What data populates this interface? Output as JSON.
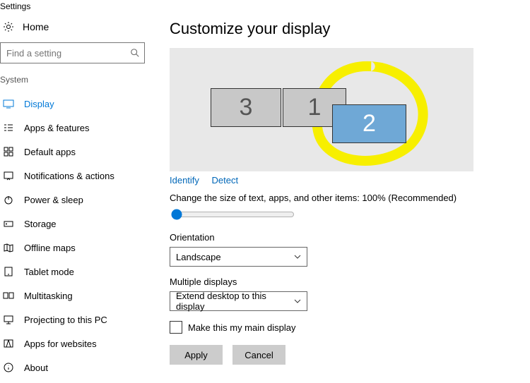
{
  "app_title": "Settings",
  "home_label": "Home",
  "search_placeholder": "Find a setting",
  "section_label": "System",
  "nav": [
    {
      "key": "display",
      "label": "Display",
      "active": true
    },
    {
      "key": "apps",
      "label": "Apps & features"
    },
    {
      "key": "default-apps",
      "label": "Default apps"
    },
    {
      "key": "notifications",
      "label": "Notifications & actions"
    },
    {
      "key": "power",
      "label": "Power & sleep"
    },
    {
      "key": "storage",
      "label": "Storage"
    },
    {
      "key": "offline-maps",
      "label": "Offline maps"
    },
    {
      "key": "tablet",
      "label": "Tablet mode"
    },
    {
      "key": "multitask",
      "label": "Multitasking"
    },
    {
      "key": "projecting",
      "label": "Projecting to this PC"
    },
    {
      "key": "apps-web",
      "label": "Apps for websites"
    },
    {
      "key": "about",
      "label": "About"
    }
  ],
  "page_heading": "Customize your display",
  "monitors": {
    "m3": "3",
    "m1": "1",
    "m2": "2"
  },
  "identify_label": "Identify",
  "detect_label": "Detect",
  "scale_label": "Change the size of text, apps, and other items: 100% (Recommended)",
  "orientation_label": "Orientation",
  "orientation_value": "Landscape",
  "multiple_label": "Multiple displays",
  "multiple_value": "Extend desktop to this display",
  "main_display_label": "Make this my main display",
  "apply_label": "Apply",
  "cancel_label": "Cancel"
}
